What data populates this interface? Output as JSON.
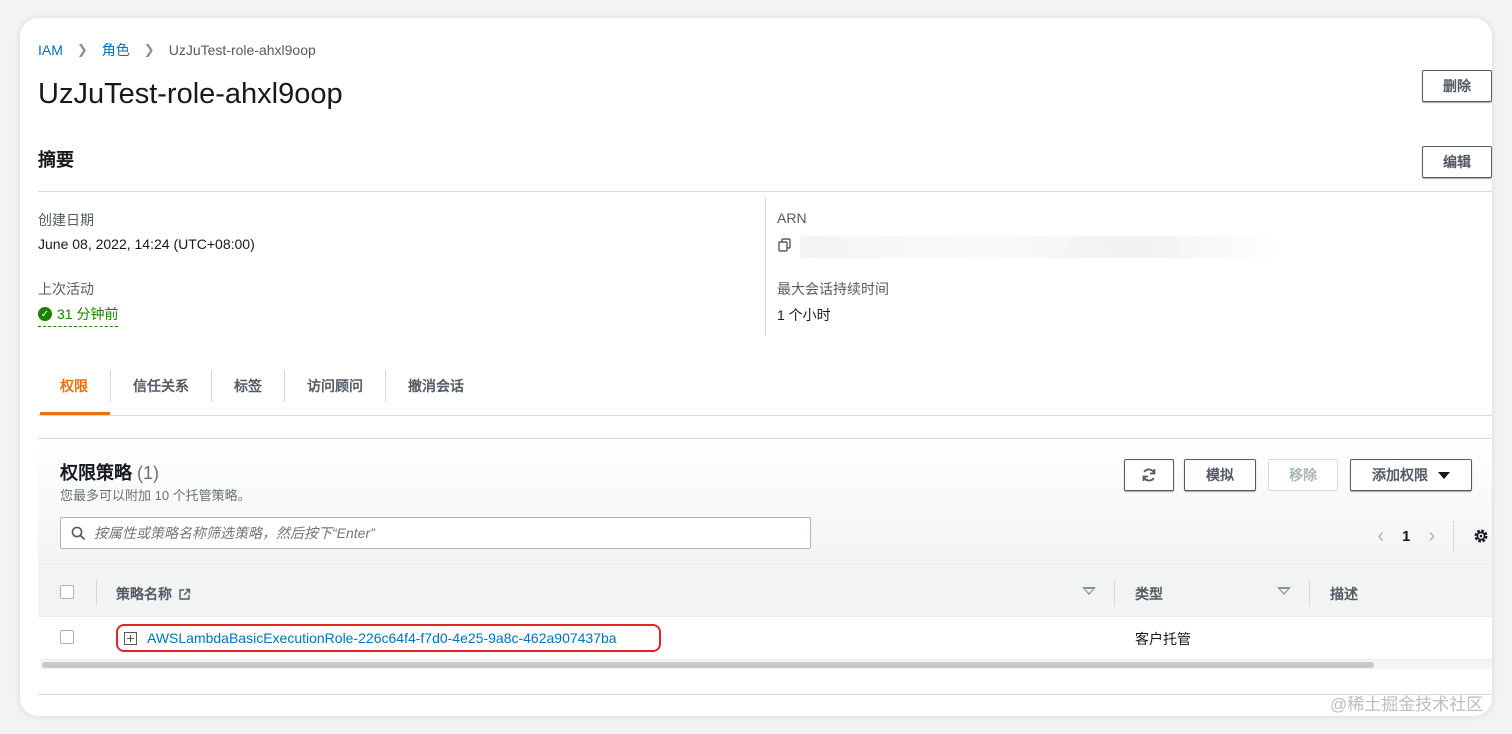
{
  "breadcrumb": {
    "root": "IAM",
    "parent": "角色",
    "current": "UzJuTest-role-ahxl9oop"
  },
  "page_title": "UzJuTest-role-ahxl9oop",
  "header_buttons": {
    "delete": "删除",
    "edit": "编辑"
  },
  "summary": {
    "title": "摘要",
    "created_label": "创建日期",
    "created_value": "June 08, 2022, 14:24 (UTC+08:00)",
    "last_activity_label": "上次活动",
    "last_activity_value": "31 分钟前",
    "arn_label": "ARN",
    "max_session_label": "最大会话持续时间",
    "max_session_value": "1 个小时"
  },
  "tabs": [
    "权限",
    "信任关系",
    "标签",
    "访问顾问",
    "撤消会话"
  ],
  "policies_panel": {
    "title": "权限策略",
    "count": "(1)",
    "subtitle": "您最多可以附加 10 个托管策略。",
    "buttons": {
      "simulate": "模拟",
      "remove": "移除",
      "add_permissions": "添加权限"
    },
    "search_placeholder": "按属性或策略名称筛选策略，然后按下“Enter”",
    "page": "1",
    "columns": {
      "name": "策略名称",
      "type": "类型",
      "description": "描述"
    },
    "rows": [
      {
        "name": "AWSLambdaBasicExecutionRole-226c64f4-f7d0-4e25-9a8c-462a907437ba",
        "type": "客户托管"
      }
    ]
  },
  "watermark": "@稀土掘金技术社区",
  "colors": {
    "link": "#0073bb",
    "accent": "#ec7211",
    "success": "#1d8102",
    "highlight": "#e0252e"
  }
}
